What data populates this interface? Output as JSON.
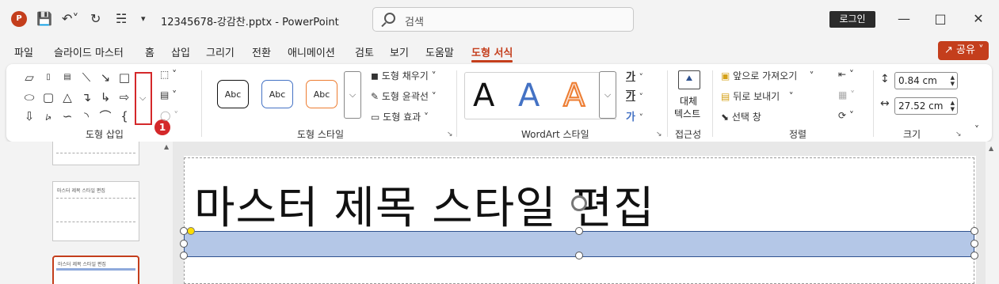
{
  "titlebar": {
    "logo": "P",
    "filename": "12345678-강감찬.pptx  -  PowerPoint",
    "search_placeholder": "검색",
    "login": "로그인"
  },
  "tabs": [
    "파일",
    "슬라이드 마스터",
    "홈",
    "삽입",
    "그리기",
    "전환",
    "애니메이션",
    "검토",
    "보기",
    "도움말",
    "도형 서식"
  ],
  "active_tab": "도형 서식",
  "share": "공유",
  "ribbon": {
    "insert_shapes": {
      "label": "도형 삽입",
      "shapes": [
        "parallelogram",
        "text-box",
        "vertical-text-box",
        "line",
        "line-arrow",
        "rectangle",
        "oval",
        "rounded-rectangle",
        "triangle",
        "elbow-connector",
        "elbow-arrow",
        "right-arrow",
        "down-arrow",
        "freeform",
        "scribble",
        "arc",
        "curve",
        "brace"
      ],
      "badge": "1"
    },
    "shape_styles": {
      "label": "도형 스타일",
      "presets": [
        "Abc",
        "Abc",
        "Abc"
      ],
      "fill": "도형 채우기",
      "outline": "도형 윤곽선",
      "effects": "도형 효과"
    },
    "wordart": {
      "label": "WordArt 스타일",
      "letters": [
        "A",
        "A",
        "A"
      ],
      "text_fill_glyph": "가",
      "text_outline_glyph": "가",
      "text_effect_glyph": "가"
    },
    "accessibility": {
      "label": "접근성",
      "alt_text_line1": "대체",
      "alt_text_line2": "텍스트"
    },
    "arrange": {
      "label": "정렬",
      "bring_forward": "앞으로 가져오기",
      "send_backward": "뒤로 보내기",
      "selection_pane": "선택 창"
    },
    "size": {
      "label": "크기",
      "height": "0.84 cm",
      "width": "27.52 cm"
    }
  },
  "slide": {
    "title": "마스터 제목 스타일 편집",
    "thumb_title": "마스터 제목 스타일 편집"
  },
  "colors": {
    "accent": "#c43e1c",
    "highlight": "#d4282a",
    "shape_fill": "#b4c7e7",
    "shape_outline": "#2f528f"
  }
}
